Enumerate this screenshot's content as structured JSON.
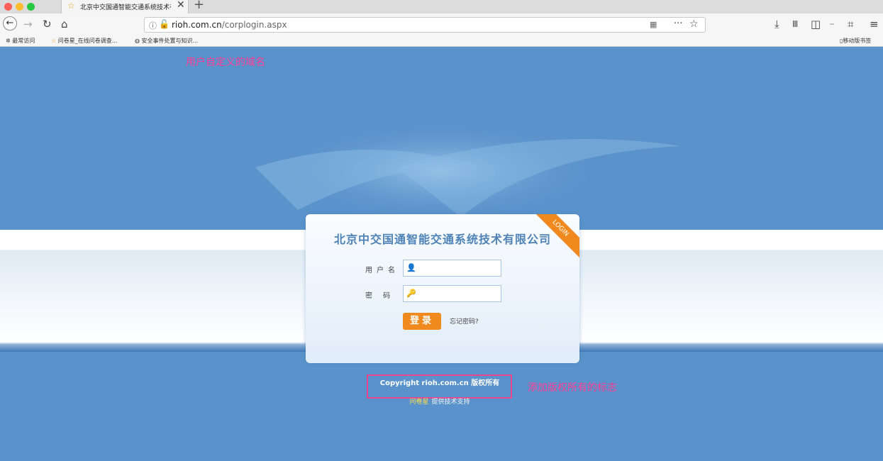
{
  "tab": {
    "title": "北京中交国通智能交通系统技术有"
  },
  "address": {
    "host": "rioh.com.cn",
    "path": "/corplogin.aspx"
  },
  "bookmarks": [
    "最常访问",
    "问卷星_在线问卷调查...",
    "安全事件处置与知识...",
    "移动版书签"
  ],
  "annotations": {
    "domain": "用户自定义的域名",
    "copyright": "添加版权所有的标志"
  },
  "login": {
    "company": "北京中交国通智能交通系统技术有限公司",
    "ribbon": "LOGIN",
    "username_label": "用户名",
    "password_label": "密 码",
    "submit": "登录",
    "forgot": "忘记密码?"
  },
  "footer": {
    "copyright": "Copyright  rioh.com.cn  版权所有",
    "support_brand": "问卷星",
    "support_text": "提供技术支持"
  },
  "colors": {
    "page_bg": "#5a93cb",
    "accent": "#f08a1e",
    "annotation": "#ff3d96"
  }
}
